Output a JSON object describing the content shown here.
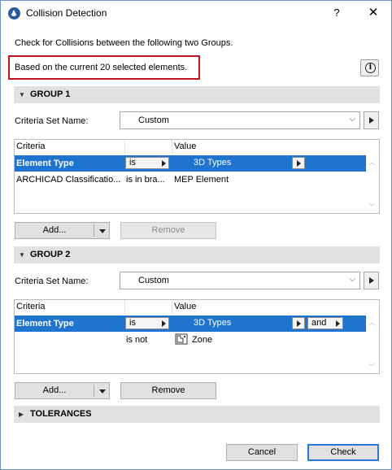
{
  "window": {
    "title": "Collision Detection",
    "help": "?",
    "close": "✕"
  },
  "intro": "Check for Collisions between the following two Groups.",
  "selection_note": "Based on the current 20 selected elements.",
  "info_icon": "i",
  "group1": {
    "header": "GROUP 1",
    "criteria_set_label": "Criteria Set Name:",
    "criteria_set_value": "Custom",
    "columns": {
      "criteria": "Criteria",
      "value": "Value"
    },
    "rows": [
      {
        "criteria": "Element Type",
        "operator": "is",
        "value": "3D Types"
      },
      {
        "criteria": "ARCHICAD Classificatio...",
        "operator": "is in bra...",
        "value": "MEP Element"
      }
    ],
    "add_label": "Add...",
    "remove_label": "Remove"
  },
  "group2": {
    "header": "GROUP 2",
    "criteria_set_label": "Criteria Set Name:",
    "criteria_set_value": "Custom",
    "columns": {
      "criteria": "Criteria",
      "value": "Value"
    },
    "rows": [
      {
        "criteria": "Element Type",
        "operator": "is",
        "value": "3D Types",
        "logic": "and"
      },
      {
        "criteria": "",
        "operator": "is not",
        "value": "Zone"
      }
    ],
    "add_label": "Add...",
    "remove_label": "Remove"
  },
  "tolerances": {
    "header": "TOLERANCES"
  },
  "footer": {
    "cancel_label": "Cancel",
    "check_label": "Check"
  },
  "colors": {
    "selection": "#1f74d0",
    "highlight_box": "#c0141e",
    "section_bg": "#e1e1e1"
  }
}
